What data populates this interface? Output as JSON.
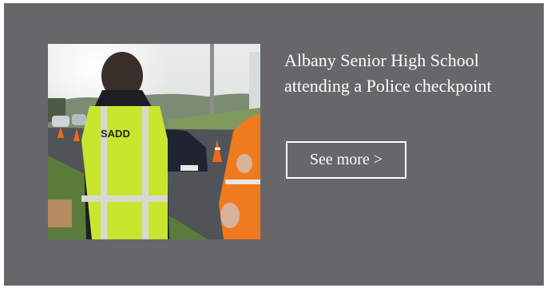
{
  "card": {
    "title": "Albany Senior High School attending a Police checkpoint",
    "button_label": "See more >",
    "vest_logo": "SADD",
    "background_color": "#67676a",
    "text_color": "#ffffff"
  }
}
